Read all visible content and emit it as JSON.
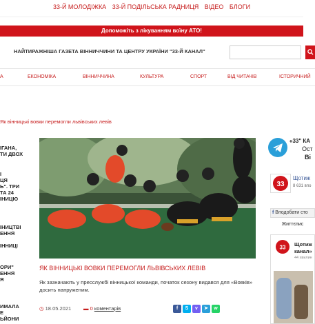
{
  "top_nav": [
    "33-Й МОЛОДІЖКА",
    "33-Й ПОДІЛЬСЬКА РАДНИЦЯ",
    "ВІДЕО",
    "БЛОГИ"
  ],
  "red_banner": "Допоможіть з лікуванням воїну АТО!",
  "tagline": "НАЙТИРАЖНІША ГАЗЕТА ВІННИЧЧИНИ ТА ЦЕНТРУ УКРАЇНИ \"33-Й КАНАЛ\"",
  "search": {
    "placeholder": "",
    "icon": "search-icon"
  },
  "main_nav": [
    "А",
    "ЕКОНОМІКА",
    "ВІННИЧЧИНА",
    "КУЛЬТУРА",
    "СПОРТ",
    "ВІД ЧИТАЧІВ",
    "ІСТОРИЧНИЙ"
  ],
  "breadcrumb": "Як вінницькі вовки перемогли львівських левів",
  "left_headlines": [
    [
      "ІГАНА,",
      "ТИ ДВОХ"
    ],
    [
      "І",
      "ЦЯ",
      "Ь\". ТРИ",
      "ТА 24",
      "ІНИЦЮ"
    ],
    [
      "ІНИЦТВІ",
      "ЕННЯ",
      "ІННИЦІ"
    ],
    [
      "ОРИ\"",
      "ЕННЯ",
      "Я"
    ],
    [
      "ИМАЛА",
      "Е",
      "ЬЙОНИ"
    ]
  ],
  "article": {
    "title": "ЯК ВІННИЦЬКІ ВОВКИ ПЕРЕМОГЛИ ЛЬВІВСЬКИХ ЛЕВІВ",
    "lede": "Як зазначають у пресслужбі вінницької команди, початок сезону видався для «Вовків» досить напруженим.",
    "date": "18.05.2021",
    "comments_count": "0",
    "comments_label": "коментарів",
    "share_icons": [
      "facebook-icon",
      "skype-icon",
      "viber-icon",
      "telegram-icon",
      "whatsapp-icon"
    ]
  },
  "sidebar": {
    "telegram_line1": "«33\" КА",
    "telegram_line2": "Ост",
    "telegram_line3": "Ві",
    "channel_name": "Щотиж",
    "channel_followers": "8 631 впо",
    "fb_like": "Вподобати сто",
    "tab_label": "Життєпис",
    "card_title_1": "Щотиж",
    "card_title_2": "канал»",
    "card_meta": "44 хвилин"
  },
  "colors": {
    "accent": "#d0141b",
    "link": "#c61c1c",
    "telegram": "#2a9fd9"
  }
}
